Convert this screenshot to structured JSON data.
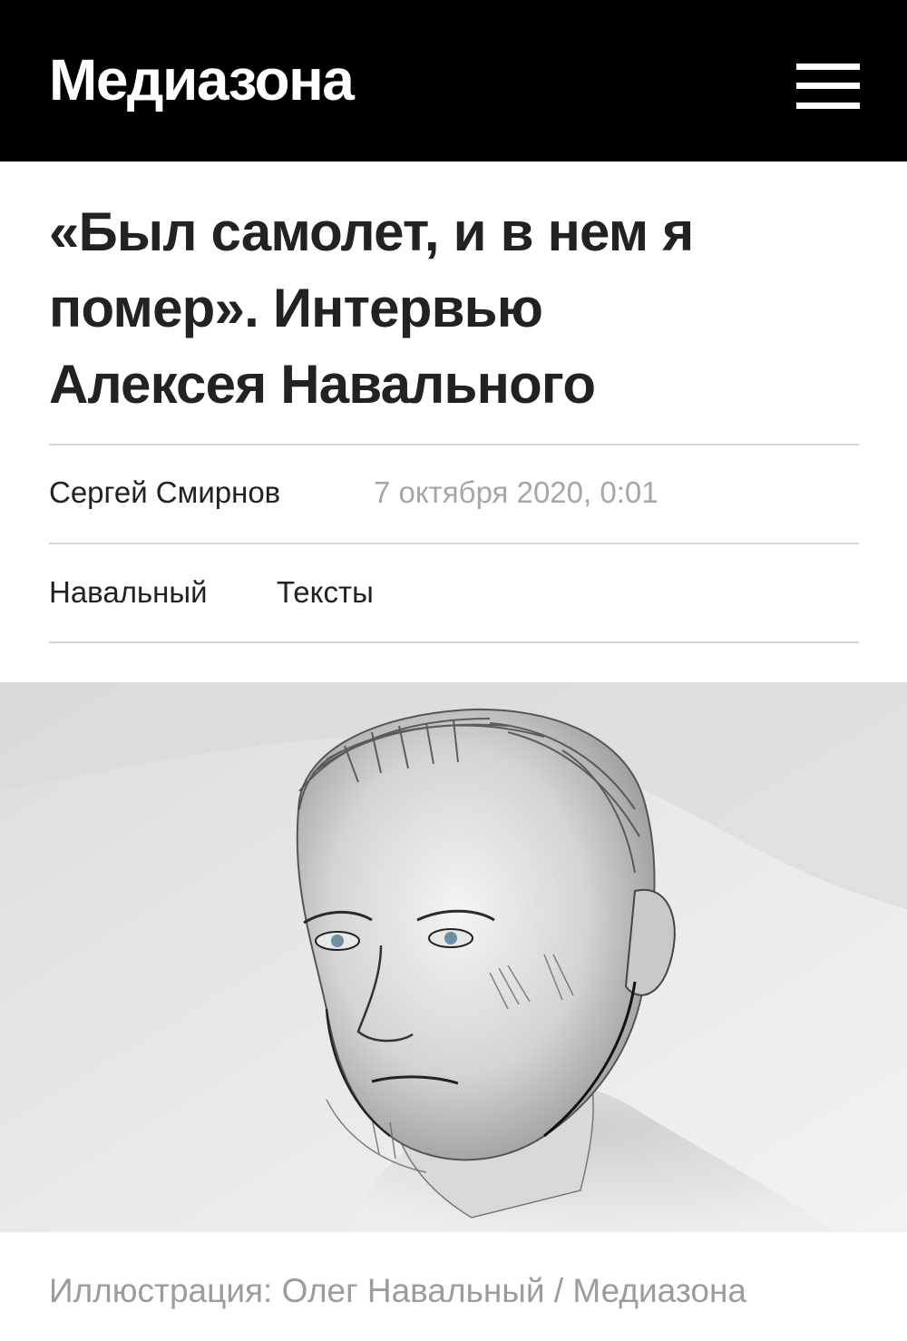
{
  "header": {
    "logo_text": "Медиазона",
    "menu_icon": "hamburger-menu-icon"
  },
  "article": {
    "headline_lines": [
      "«Был самолет, и в нем я",
      "помер». Интервью",
      "Алексея Навального"
    ],
    "author": "Сергей Смирнов",
    "date": "7 октября 2020, 0:01",
    "tags": [
      "Навальный",
      "Тексты"
    ]
  },
  "illustration": {
    "subject": "pencil-portrait-illustration",
    "caption": "Иллюстрация: Олег Навальный / Медиазона"
  },
  "colors": {
    "header_bg": "#000000",
    "header_text": "#ffffff",
    "headline": "#222222",
    "meta_date": "#a6a6a6",
    "caption": "#9c9c9c",
    "divider": "#d6d6d6"
  }
}
